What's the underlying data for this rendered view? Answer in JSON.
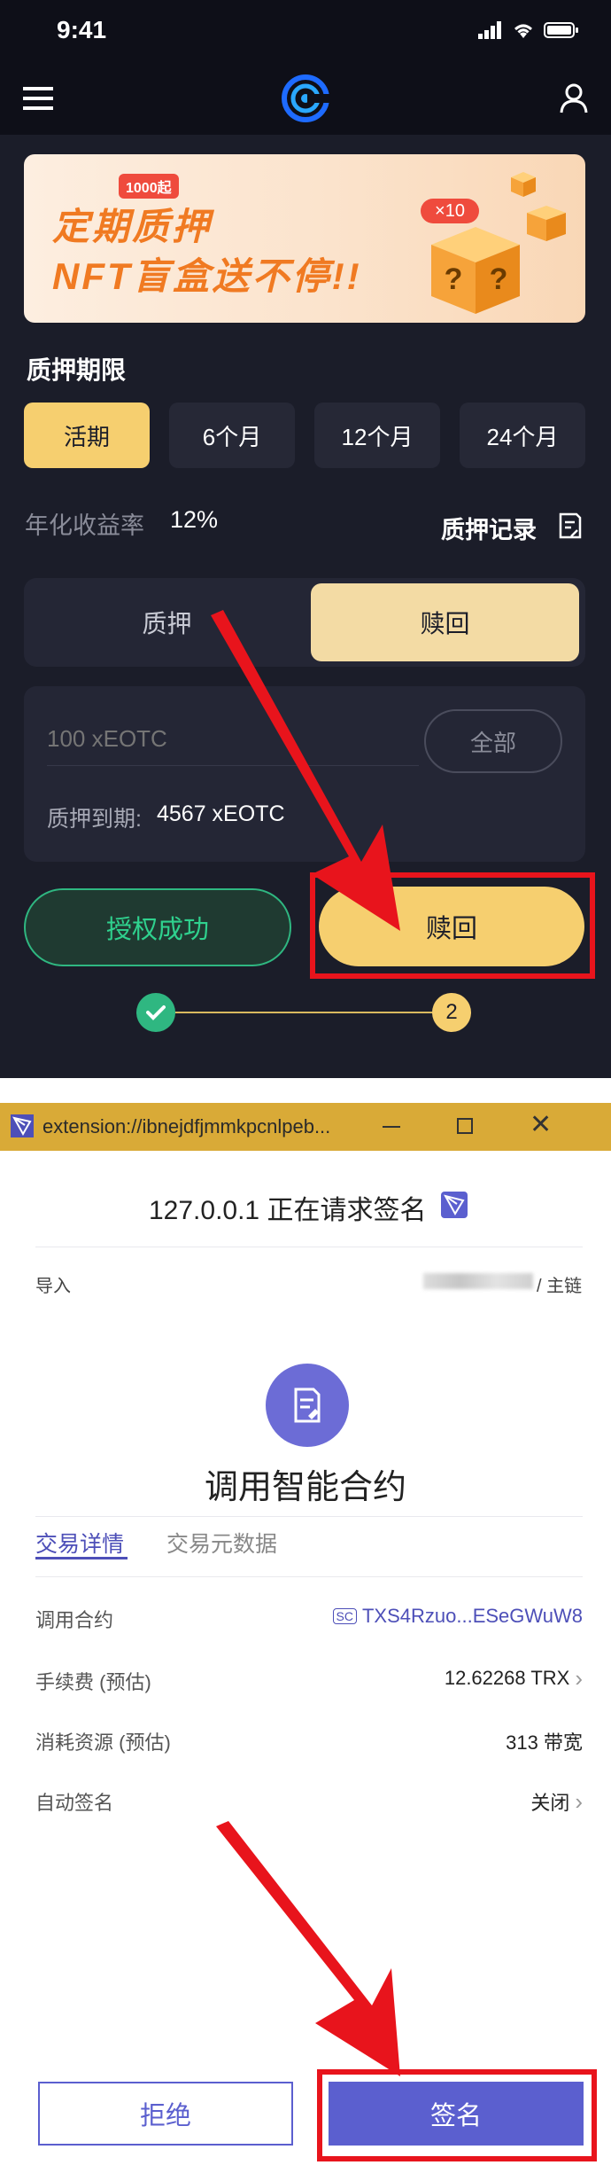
{
  "status_bar": {
    "time": "9:41"
  },
  "banner": {
    "badge": "1000起",
    "line1": "定期质押",
    "line2": "NFT盲盒送不停!!",
    "multiplier": "×10"
  },
  "stake_period": {
    "title": "质押期限",
    "options": [
      "活期",
      "6个月",
      "12个月",
      "24个月"
    ],
    "selected": "活期"
  },
  "rate": {
    "label": "年化收益率",
    "value": "12%"
  },
  "records_link": "质押记录",
  "mode_tabs": {
    "stake": "质押",
    "redeem": "赎回",
    "active": "赎回"
  },
  "amount": {
    "placeholder": "100 xEOTC",
    "all_button": "全部",
    "expiry_label": "质押到期:",
    "expiry_value": "4567 xEOTC"
  },
  "actions": {
    "authorized": "授权成功",
    "redeem": "赎回"
  },
  "steps": {
    "current": "2"
  },
  "extension": {
    "url": "extension://ibnejdfjmmkpcnlpeb...",
    "request_title": "127.0.0.1 正在请求签名",
    "import_label": "导入",
    "chain_label": "/ 主链",
    "contract_title": "调用智能合约",
    "tabs": {
      "details": "交易详情",
      "metadata": "交易元数据"
    },
    "rows": [
      {
        "label": "调用合约",
        "value": "TXS4Rzuo...ESeGWuW8",
        "tag": "SC"
      },
      {
        "label": "手续费 (预估)",
        "value": "12.62268 TRX"
      },
      {
        "label": "消耗资源 (预估)",
        "value": "313 带宽"
      },
      {
        "label": "自动签名",
        "value": "关闭"
      }
    ],
    "reject": "拒绝",
    "sign": "签名"
  },
  "colors": {
    "app_bg": "#1b1d29",
    "accent_gold": "#f6cf6f",
    "success_green": "#2fb781",
    "ext_accent": "#5b5fcf",
    "highlight_red": "#e8141c"
  }
}
